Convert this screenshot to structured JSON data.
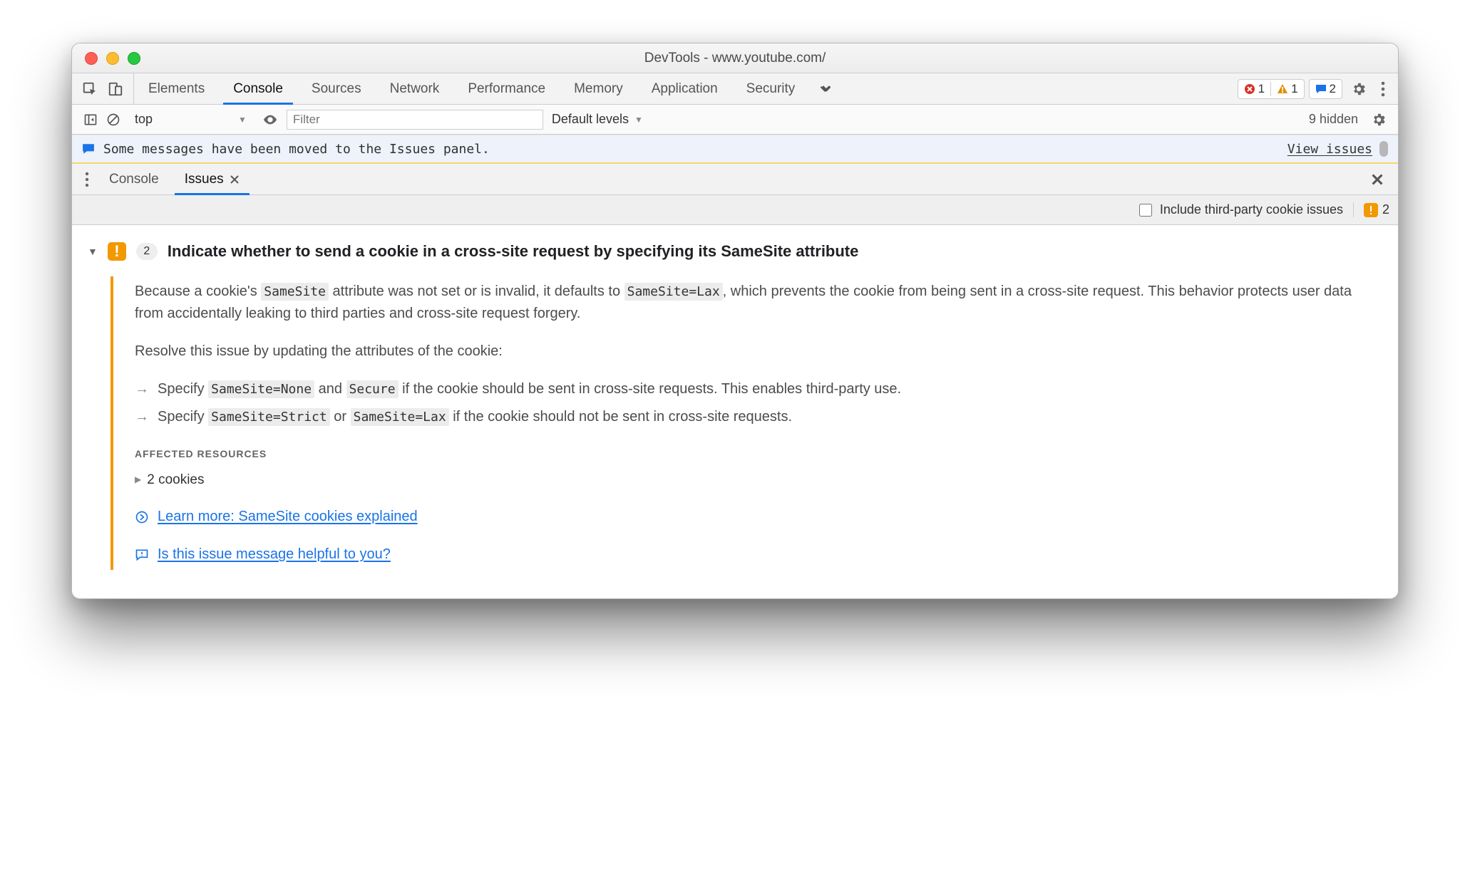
{
  "window": {
    "title": "DevTools - www.youtube.com/"
  },
  "main_tabs": {
    "items": [
      "Elements",
      "Console",
      "Sources",
      "Network",
      "Performance",
      "Memory",
      "Application",
      "Security"
    ],
    "active": "Console"
  },
  "counters": {
    "errors": "1",
    "warnings": "1",
    "messages": "2"
  },
  "secbar": {
    "context": "top",
    "context_caret": "▼",
    "filter_placeholder": "Filter",
    "default_levels": "Default levels",
    "hidden": "9 hidden"
  },
  "banner": {
    "text": "Some messages have been moved to the Issues panel.",
    "link": "View issues"
  },
  "drawer": {
    "tabs": {
      "items": [
        "Console",
        "Issues"
      ],
      "active": "Issues"
    },
    "opt_label": "Include third-party cookie issues",
    "issue_total": "2"
  },
  "issue": {
    "count": "2",
    "title": "Indicate whether to send a cookie in a cross-site request by specifying its SameSite attribute",
    "p1_a": "Because a cookie's ",
    "p1_b": " attribute was not set or is invalid, it defaults to ",
    "p1_c": ", which prevents the cookie from being sent in a cross-site request. This behavior protects user data from accidentally leaking to third parties and cross-site request forgery.",
    "p2": "Resolve this issue by updating the attributes of the cookie:",
    "b1_a": "Specify ",
    "b1_b": " and ",
    "b1_c": " if the cookie should be sent in cross-site requests. This enables third-party use.",
    "b2_a": "Specify ",
    "b2_b": " or ",
    "b2_c": " if the cookie should not be sent in cross-site requests.",
    "code_samesite": "SameSite",
    "code_lax_default": "SameSite=Lax",
    "code_none": "SameSite=None",
    "code_secure": "Secure",
    "code_strict": "SameSite=Strict",
    "code_lax": "SameSite=Lax",
    "section_label": "AFFECTED RESOURCES",
    "affected": "2 cookies",
    "learn_more": "Learn more: SameSite cookies explained",
    "feedback": "Is this issue message helpful to you?"
  }
}
